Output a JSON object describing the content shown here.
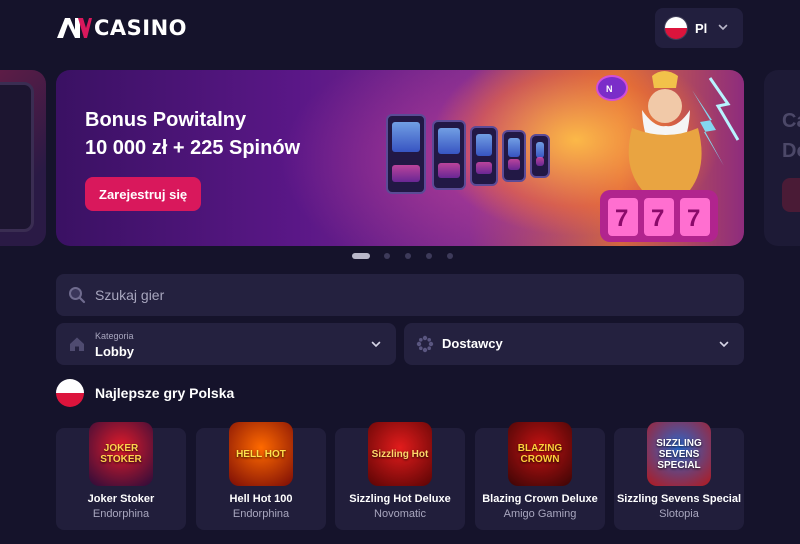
{
  "header": {
    "logo_text": "CASINO",
    "language": "Pl"
  },
  "banner": {
    "title_line1": "Bonus Powitalny",
    "title_line2": "10 000 zł + 225 Spinów",
    "cta_label": "Zarejestruj się"
  },
  "side_banner": {
    "line1": "Ca",
    "line2": "Do"
  },
  "carousel": {
    "slide_count": 5,
    "active_index": 0
  },
  "search": {
    "placeholder": "Szukaj gier"
  },
  "filters": {
    "category_label": "Kategoria",
    "category_value": "Lobby",
    "providers_label": "Dostawcy"
  },
  "section": {
    "title": "Najlepsze gry Polska"
  },
  "games": [
    {
      "name": "Joker Stoker",
      "provider": "Endorphina",
      "thumb_text": "JOKER STOKER",
      "colors": [
        "#e01b2a",
        "#2a0c3a"
      ],
      "text_color": "#ffd34d"
    },
    {
      "name": "Hell Hot 100",
      "provider": "Endorphina",
      "thumb_text": "HELL HOT",
      "colors": [
        "#ff6a00",
        "#7a0b06"
      ],
      "text_color": "#ffe04a"
    },
    {
      "name": "Sizzling Hot Deluxe",
      "provider": "Novomatic",
      "thumb_text": "Sizzling Hot",
      "colors": [
        "#e21c1c",
        "#590404"
      ],
      "text_color": "#ffd86b"
    },
    {
      "name": "Blazing Crown Deluxe",
      "provider": "Amigo Gaming",
      "thumb_text": "BLAZING CROWN",
      "colors": [
        "#c41212",
        "#3a0505"
      ],
      "text_color": "#ffcf3a"
    },
    {
      "name": "Sizzling Sevens Special",
      "provider": "Slotopia",
      "thumb_text": "SIZZLING SEVENS SPECIAL",
      "colors": [
        "#2b66c9",
        "#b3191e"
      ],
      "text_color": "#ffffff"
    }
  ]
}
